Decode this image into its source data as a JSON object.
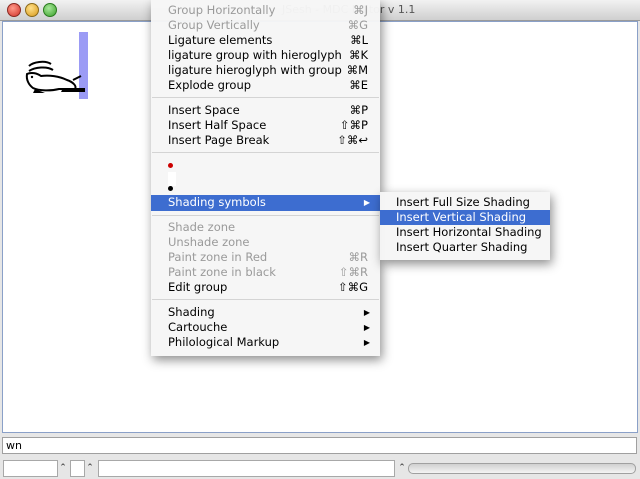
{
  "window": {
    "title": "JSesh - MDC Editor v 1.1",
    "bottom_text": "wn",
    "stepper_symbol": "⌃",
    "slider_symbol": "⌃"
  },
  "menu": {
    "items": [
      {
        "label": "Group Horizontally",
        "shortcut": "⌘J",
        "disabled": true
      },
      {
        "label": "Group Vertically",
        "shortcut": "⌘G",
        "disabled": true
      },
      {
        "label": "Ligature elements",
        "shortcut": "⌘L",
        "disabled": false
      },
      {
        "label": "ligature group with hieroglyph",
        "shortcut": "⌘K",
        "disabled": false
      },
      {
        "label": "ligature hieroglyph with group",
        "shortcut": "⌘M",
        "disabled": false
      },
      {
        "label": "Explode group",
        "shortcut": "⌘E",
        "disabled": false
      },
      {
        "label": "Insert Space",
        "shortcut": "⌘P",
        "disabled": false
      },
      {
        "label": "Insert Half Space",
        "shortcut": "⇧⌘P",
        "disabled": false
      },
      {
        "label": "Insert Page Break",
        "shortcut": "⇧⌘↩",
        "disabled": false
      },
      {
        "label": "Shading symbols",
        "arrow": "▶",
        "selected": true
      },
      {
        "label": "Shade zone",
        "shortcut": "",
        "disabled": true
      },
      {
        "label": "Unshade zone",
        "shortcut": "",
        "disabled": true
      },
      {
        "label": "Paint zone in Red",
        "shortcut": "⌘R",
        "disabled": true
      },
      {
        "label": "Paint zone in black",
        "shortcut": "⇧⌘R",
        "disabled": true
      },
      {
        "label": "Edit group",
        "shortcut": "⇧⌘G",
        "disabled": false
      },
      {
        "label": "Shading",
        "arrow": "▶"
      },
      {
        "label": "Cartouche",
        "arrow": "▶"
      },
      {
        "label": "Philological Markup",
        "arrow": "▶"
      }
    ],
    "colors": {
      "red_dot": "#cc0000",
      "black_dot": "#000000",
      "highlight": "#3d6dd0"
    }
  },
  "submenu": {
    "items": [
      {
        "label": "Insert Full Size Shading"
      },
      {
        "label": "Insert Vertical Shading",
        "selected": true
      },
      {
        "label": "Insert Horizontal Shading"
      },
      {
        "label": "Insert Quarter Shading"
      }
    ]
  }
}
